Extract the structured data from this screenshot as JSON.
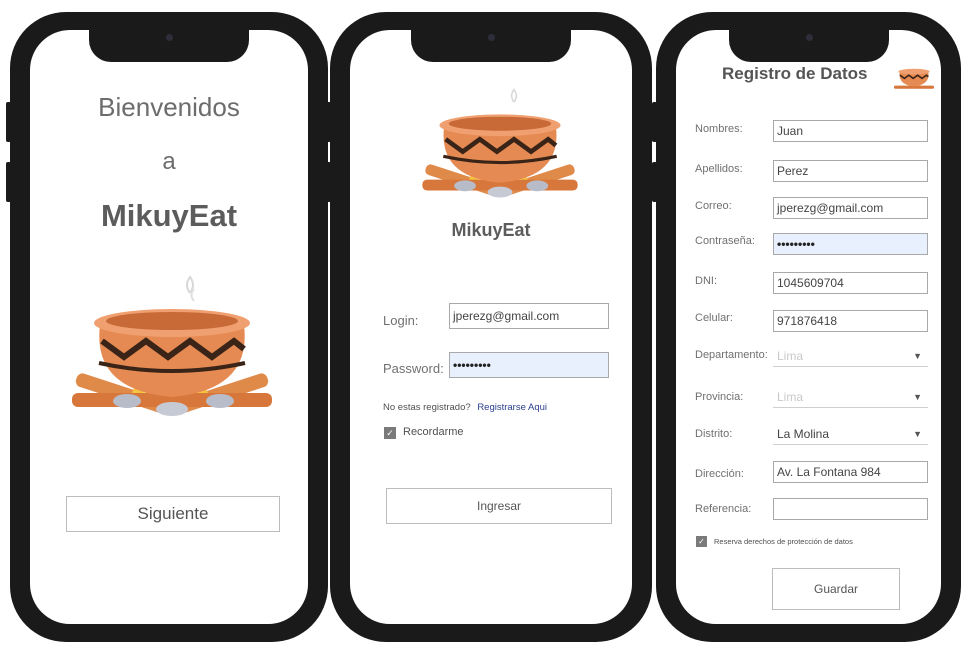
{
  "screen1": {
    "welcome_line1": "Bienvenidos",
    "welcome_line2": "a",
    "app_name": "MikuyEat",
    "next_button": "Siguiente"
  },
  "screen2": {
    "app_name": "MikuyEat",
    "login_label": "Login:",
    "login_value": "jperezg@gmail.com",
    "password_label": "Password:",
    "password_value": "•••••••••",
    "not_registered_text": "No estas registrado?",
    "register_link": "Registrarse Aqui",
    "remember_label": "Recordarme",
    "remember_checked": true,
    "submit_button": "Ingresar"
  },
  "screen3": {
    "title": "Registro de Datos",
    "fields": {
      "nombres": {
        "label": "Nombres:",
        "value": "Juan"
      },
      "apellidos": {
        "label": "Apellidos:",
        "value": "Perez"
      },
      "correo": {
        "label": "Correo:",
        "value": "jperezg@gmail.com"
      },
      "contrasena": {
        "label": "Contraseña:",
        "value": "•••••••••"
      },
      "dni": {
        "label": "DNI:",
        "value": "1045609704"
      },
      "celular": {
        "label": "Celular:",
        "value": "971876418"
      },
      "departamento": {
        "label": "Departamento:",
        "value": "Lima"
      },
      "provincia": {
        "label": "Provincia:",
        "value": "Lima"
      },
      "distrito": {
        "label": "Distrito:",
        "value": "La Molina"
      },
      "direccion": {
        "label": "Dirección:",
        "value": "Av. La Fontana 984"
      },
      "referencia": {
        "label": "Referencia:",
        "value": ""
      }
    },
    "privacy_label": "Reserva derechos de protección de datos",
    "privacy_checked": true,
    "save_button": "Guardar"
  },
  "colors": {
    "phone_frame": "#1a1a1a",
    "pot_body": "#e58a52",
    "pot_rim": "#f0a070",
    "pot_band": "#3a2418",
    "wood": "#e08a4a",
    "flame": "#f5c542",
    "autofill_bg": "#e8f0fe"
  }
}
